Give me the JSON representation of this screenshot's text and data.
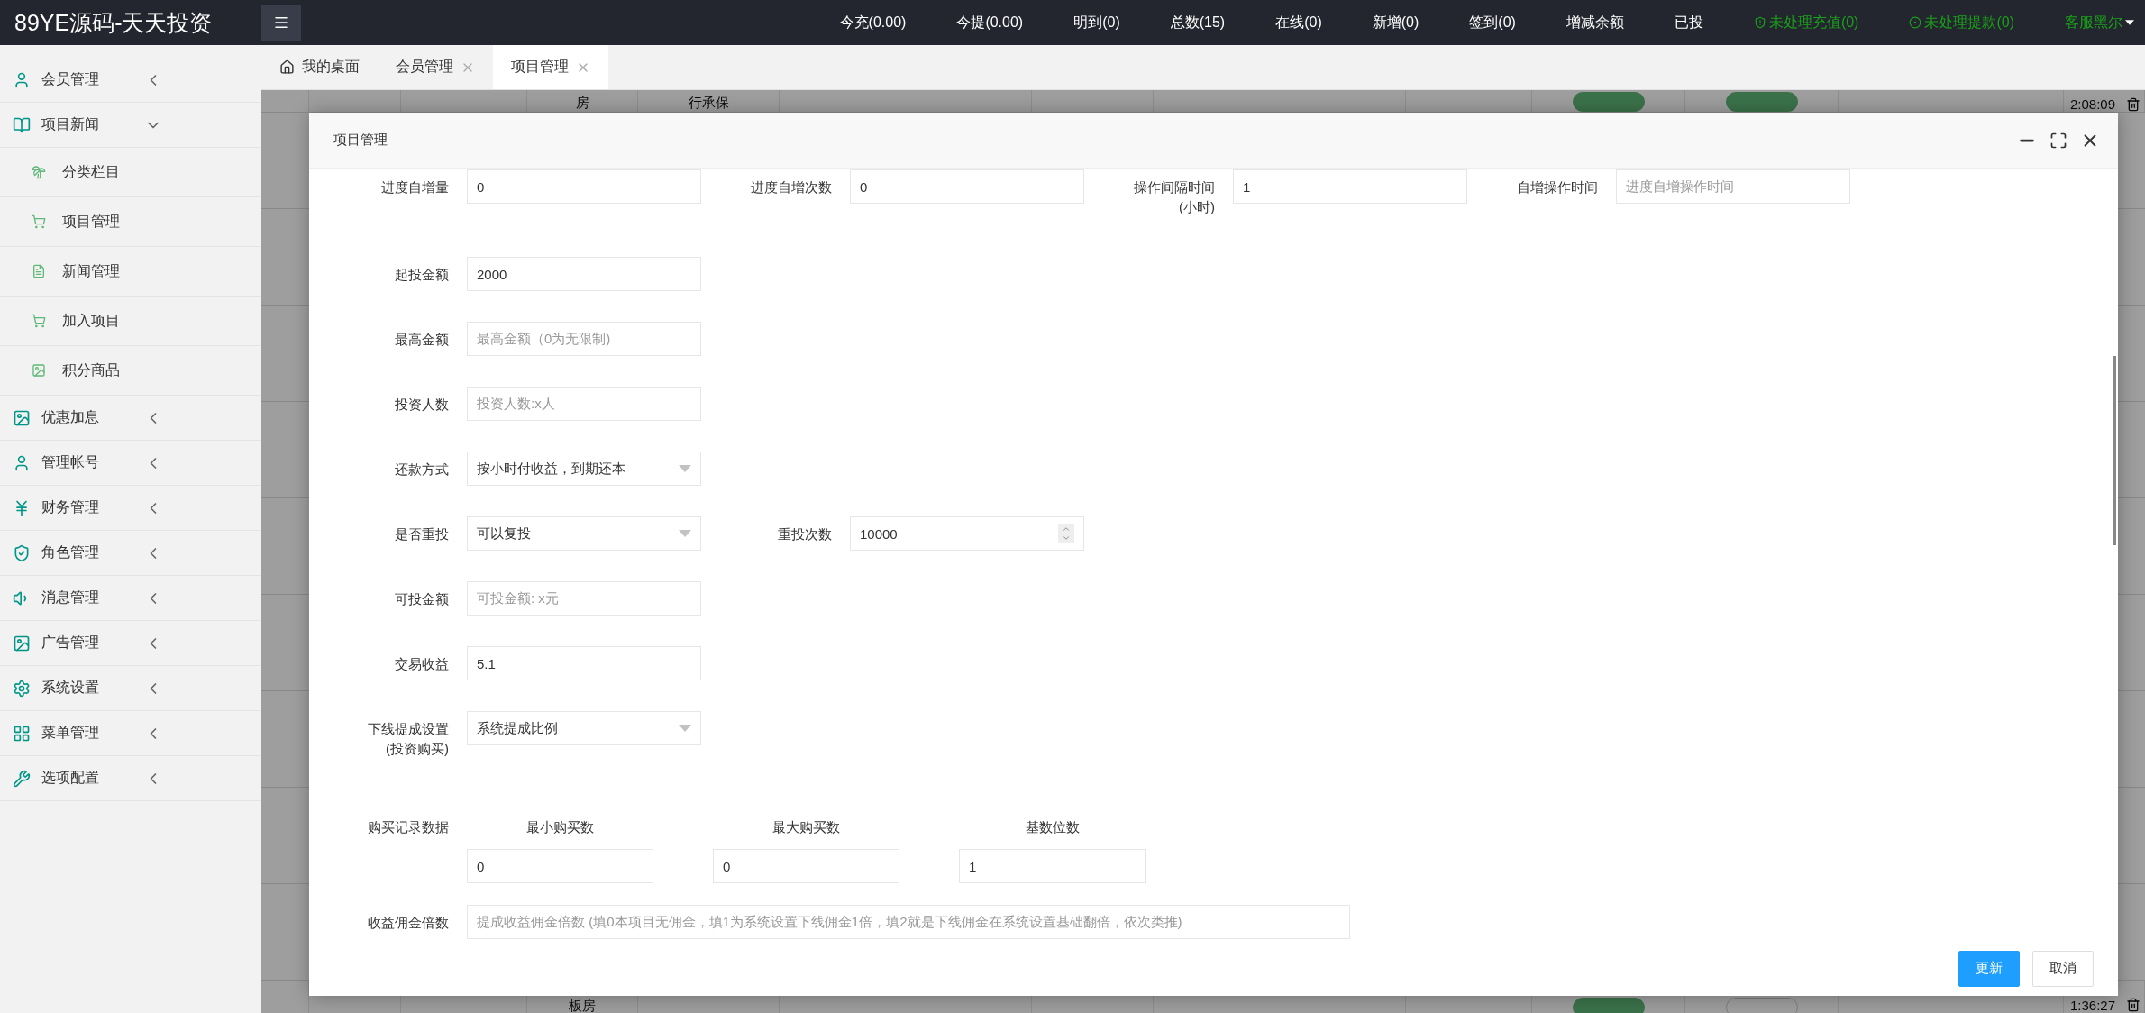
{
  "brand": "89YE源码-天天投资",
  "top_nav": [
    {
      "label": "今充(0.00)",
      "kind": "stat"
    },
    {
      "label": "今提(0.00)",
      "kind": "stat"
    },
    {
      "label": "明到(0)",
      "kind": "stat"
    },
    {
      "label": "总数(15)",
      "kind": "stat"
    },
    {
      "label": "在线(0)",
      "kind": "stat"
    },
    {
      "label": "新增(0)",
      "kind": "stat"
    },
    {
      "label": "签到(0)",
      "kind": "stat"
    },
    {
      "label": "增减余额",
      "kind": "stat"
    },
    {
      "label": "已投",
      "kind": "stat"
    },
    {
      "label": "未处理充值(0)",
      "kind": "alert"
    },
    {
      "label": "未处理提款(0)",
      "kind": "alert"
    },
    {
      "label": "客服黑尔",
      "kind": "user"
    }
  ],
  "sidebar": {
    "items": [
      {
        "label": "会员管理",
        "expanded": false
      },
      {
        "label": "项目新闻",
        "expanded": true,
        "children": [
          {
            "label": "分类栏目"
          },
          {
            "label": "项目管理"
          },
          {
            "label": "新闻管理"
          },
          {
            "label": "加入项目"
          },
          {
            "label": "积分商品"
          }
        ]
      },
      {
        "label": "优惠加息",
        "expanded": false
      },
      {
        "label": "管理帐号",
        "expanded": false
      },
      {
        "label": "财务管理",
        "expanded": false
      },
      {
        "label": "角色管理",
        "expanded": false
      },
      {
        "label": "消息管理",
        "expanded": false
      },
      {
        "label": "广告管理",
        "expanded": false
      },
      {
        "label": "系统设置",
        "expanded": false
      },
      {
        "label": "菜单管理",
        "expanded": false
      },
      {
        "label": "选项配置",
        "expanded": false
      }
    ]
  },
  "tabs": [
    {
      "label": "我的桌面",
      "kind": "home",
      "selected": false
    },
    {
      "label": "会员管理",
      "kind": "closable",
      "selected": false
    },
    {
      "label": "项目管理",
      "kind": "closable",
      "selected": true
    }
  ],
  "background_table": {
    "rows": [
      {
        "cells": [
          {
            "kind": "empty"
          },
          {
            "kind": "empty"
          },
          {
            "kind": "empty"
          },
          {
            "kind": "text",
            "text": "房"
          },
          {
            "kind": "text",
            "text": "行承保"
          },
          {
            "kind": "empty"
          },
          {
            "kind": "empty"
          },
          {
            "kind": "empty"
          },
          {
            "kind": "empty"
          },
          {
            "kind": "toggle",
            "on": true
          },
          {
            "kind": "toggle",
            "on": true
          },
          {
            "kind": "empty"
          },
          {
            "kind": "text",
            "text": "2:08:09"
          },
          {
            "kind": "trash"
          }
        ]
      },
      {
        "cells": [
          {
            "kind": "empty"
          },
          {
            "kind": "empty"
          },
          {
            "kind": "empty"
          },
          {
            "kind": "text",
            "text": "板房"
          },
          {
            "kind": "empty"
          },
          {
            "kind": "empty"
          },
          {
            "kind": "empty"
          },
          {
            "kind": "empty"
          },
          {
            "kind": "empty"
          },
          {
            "kind": "toggle",
            "on": true
          },
          {
            "kind": "toggle",
            "on": false
          },
          {
            "kind": "empty"
          },
          {
            "kind": "text",
            "text": "1:36:27"
          },
          {
            "kind": "trash"
          }
        ]
      }
    ]
  },
  "modal": {
    "title": "项目管理",
    "rows": [
      {
        "kind": "fields",
        "fields": [
          {
            "label": "进度自增量",
            "kind": "text",
            "value": "0"
          },
          {
            "label": "进度自增次数",
            "kind": "text",
            "value": "0"
          },
          {
            "label": "操作间隔时间",
            "note": "(小时)",
            "kind": "text",
            "value": "1"
          },
          {
            "label": "自增操作时间",
            "kind": "text",
            "placeholder": "进度自增操作时间"
          }
        ]
      },
      {
        "kind": "fields",
        "fields": [
          {
            "label": "起投金额",
            "kind": "text",
            "value": "2000"
          }
        ]
      },
      {
        "kind": "fields",
        "fields": [
          {
            "label": "最高金额",
            "kind": "text",
            "placeholder": "最高金额（0为无限制)"
          }
        ]
      },
      {
        "kind": "fields",
        "fields": [
          {
            "label": "投资人数",
            "kind": "text",
            "placeholder": "投资人数:x人"
          }
        ]
      },
      {
        "kind": "fields",
        "fields": [
          {
            "label": "还款方式",
            "kind": "select",
            "value": "按小时付收益，到期还本"
          }
        ]
      },
      {
        "kind": "fields",
        "fields": [
          {
            "label": "是否重投",
            "kind": "select",
            "value": "可以复投"
          },
          {
            "label": "重投次数",
            "kind": "number",
            "value": "10000"
          }
        ]
      },
      {
        "kind": "fields",
        "fields": [
          {
            "label": "可投金额",
            "kind": "text",
            "placeholder": "可投金额: x元"
          }
        ]
      },
      {
        "kind": "fields",
        "fields": [
          {
            "label": "交易收益",
            "kind": "text",
            "value": "5.1"
          }
        ]
      },
      {
        "kind": "fields",
        "fields": [
          {
            "label": "下线提成设置",
            "note": "(投资购买)",
            "kind": "select",
            "value": "系统提成比例"
          }
        ]
      },
      {
        "kind": "columns",
        "label": "购买记录数据",
        "columns": [
          {
            "heading": "最小购买数",
            "value": "0"
          },
          {
            "heading": "最大购买数",
            "value": "0"
          },
          {
            "heading": "基数位数",
            "value": "1"
          }
        ]
      },
      {
        "kind": "wide",
        "label": "收益佣金倍数",
        "placeholder": "提成收益佣金倍数 (填0本项目无佣金，填1为系统设置下线佣金1倍，填2就是下线佣金在系统设置基础翻倍，依次类推)"
      }
    ],
    "buttons": [
      {
        "label": "更新",
        "kind": "primary"
      },
      {
        "label": "取消",
        "kind": "secondary"
      }
    ]
  }
}
